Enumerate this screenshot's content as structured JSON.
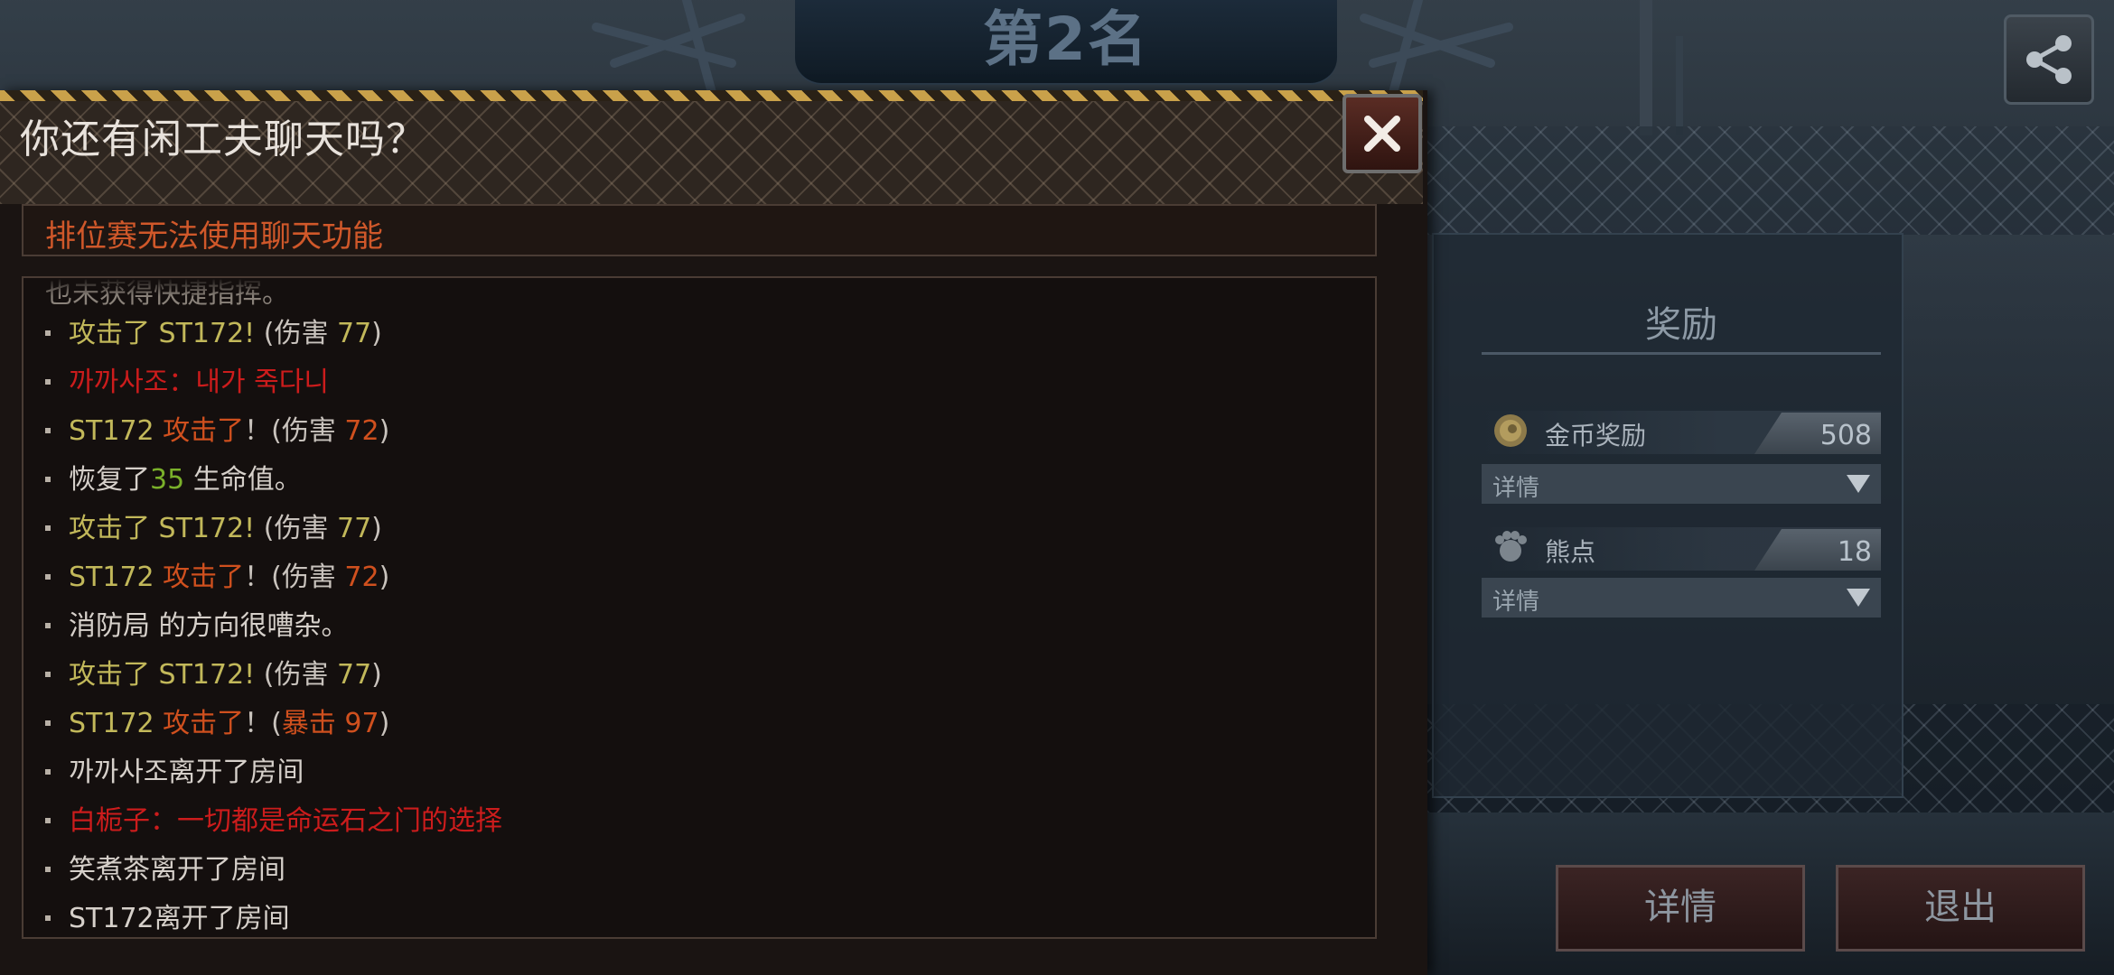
{
  "header": {
    "rank_title": "第2名"
  },
  "chat": {
    "title": "你还有闲工夫聊天吗？",
    "notice": "排位赛无法使用聊天功能",
    "cut_off_line": "也未获得快捷指挥。",
    "lines": [
      {
        "p1": "攻击了 ST172!",
        "p2": " (伤害 ",
        "p3": "77",
        "p4": ")"
      },
      {
        "text": "까까사조：내가 죽다니"
      },
      {
        "p1": "ST172  ",
        "p2": "攻击了",
        "p3": "！(伤害 ",
        "p4": "72",
        "p5": ")"
      },
      {
        "p1": "恢复了",
        "p2": "35",
        "p3": " 生命值。"
      },
      {
        "p1": "攻击了 ST172!",
        "p2": " (伤害 ",
        "p3": "77",
        "p4": ")"
      },
      {
        "p1": "ST172  ",
        "p2": "攻击了",
        "p3": "！(伤害 ",
        "p4": "72",
        "p5": ")"
      },
      {
        "text": "消防局 的方向很嘈杂。"
      },
      {
        "p1": "攻击了 ST172!",
        "p2": " (伤害 ",
        "p3": "77",
        "p4": ")"
      },
      {
        "p1": "ST172  ",
        "p2": "攻击了",
        "p3": "！(",
        "p4": "暴击 97",
        "p5": ")"
      },
      {
        "text": "까까사조离开了房间"
      },
      {
        "text": "白栀子：一切都是命运石之门的选择"
      },
      {
        "text": "笑煮茶离开了房间"
      },
      {
        "text": "ST172离开了房间"
      }
    ]
  },
  "rewards": {
    "title": "奖励",
    "gold": {
      "label": "金币奖励",
      "value": "508",
      "icon": "gold-coin-icon"
    },
    "bear": {
      "label": "熊点",
      "value": "18",
      "icon": "bear-paw-icon"
    },
    "detail_label": "详情"
  },
  "buttons": {
    "details": "详情",
    "exit": "退出"
  },
  "colors": {
    "chat_yellow": "#c2b85a",
    "chat_red": "#cc1c1c",
    "chat_orange": "#d0501e",
    "chat_green": "#7ab02a",
    "hazard": "#c9a14a"
  }
}
